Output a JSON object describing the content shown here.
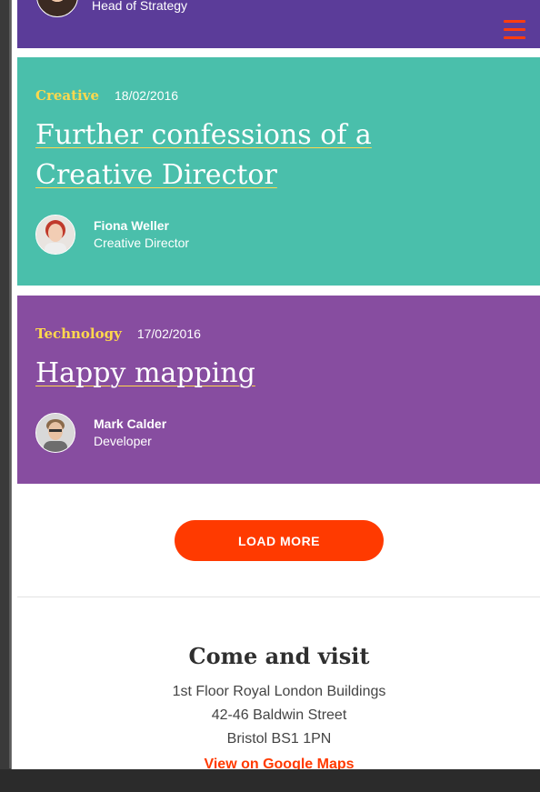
{
  "top_card": {
    "author_role": "Head of Strategy",
    "menu_icon": "hamburger-icon"
  },
  "articles": [
    {
      "category": "Creative",
      "date": "18/02/2016",
      "title": "Further confessions of a Creative Director",
      "author_name": "Fiona Weller",
      "author_role": "Creative Director",
      "background": "#4abfab"
    },
    {
      "category": "Technology",
      "date": "17/02/2016",
      "title": "Happy mapping",
      "author_name": "Mark Calder",
      "author_role": "Developer",
      "background": "#874da0"
    }
  ],
  "load_more": {
    "label": "LOAD MORE"
  },
  "visit": {
    "heading": "Come and visit",
    "address_line1": "1st Floor Royal London Buildings",
    "address_line2": "42-46 Baldwin Street",
    "address_line3": "Bristol BS1 1PN",
    "map_link": "View on Google Maps"
  },
  "colors": {
    "accent": "#ff3a00",
    "category": "#ffd84d",
    "header_purple": "#5b3c99"
  }
}
